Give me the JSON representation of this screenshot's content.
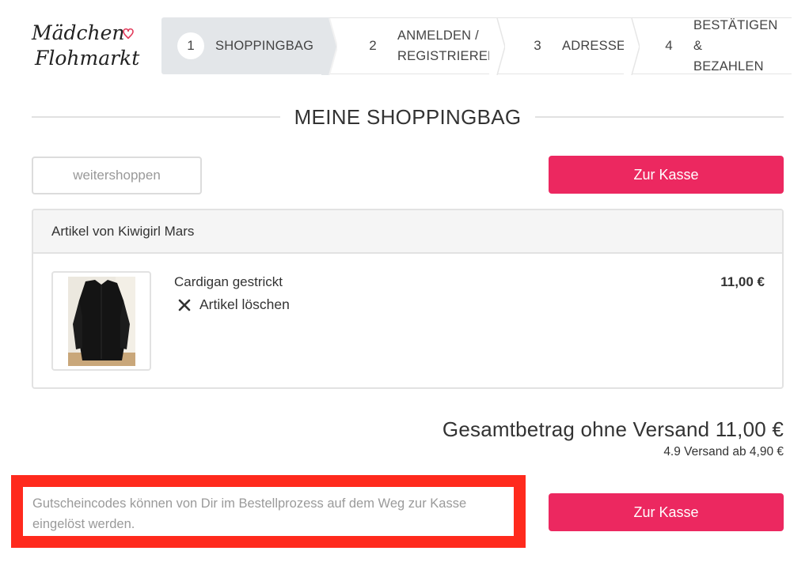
{
  "header": {
    "logo": {
      "line1": "Mädchen",
      "line2": "Flohmarkt"
    },
    "steps": [
      {
        "number": "1",
        "label_line1": "SHOPPINGBAG",
        "label_line2": "",
        "label_line3": ""
      },
      {
        "number": "2",
        "label_line1": "ANMELDEN /",
        "label_line2": "REGISTRIEREN",
        "label_line3": ""
      },
      {
        "number": "3",
        "label_line1": "ADRESSE",
        "label_line2": "",
        "label_line3": ""
      },
      {
        "number": "4",
        "label_line1": "BESTÄTIGEN",
        "label_line2": "&",
        "label_line3": "BEZAHLEN"
      }
    ]
  },
  "main": {
    "title": "MEINE SHOPPINGBAG",
    "continue_label": "weitershoppen",
    "checkout_label": "Zur Kasse",
    "seller_heading": "Artikel von Kiwigirl Mars",
    "items": [
      {
        "name": "Cardigan gestrickt",
        "delete_label": "Artikel löschen",
        "price": "11,00 €"
      }
    ],
    "total": "Gesamtbetrag ohne Versand 11,00 €",
    "shipping": "4.9 Versand ab 4,90 €",
    "voucher_note": "Gutscheincodes können von Dir im Bestellprozess auf dem Weg zur Kasse eingelöst werden."
  },
  "colors": {
    "accent": "#ec2860",
    "highlight_border": "#ff2a1d",
    "active_step": "#e3e6e9"
  },
  "icons": {
    "delete": "close-icon",
    "step_separator": "chevron-right-icon",
    "logo_heart": "heart-icon"
  }
}
